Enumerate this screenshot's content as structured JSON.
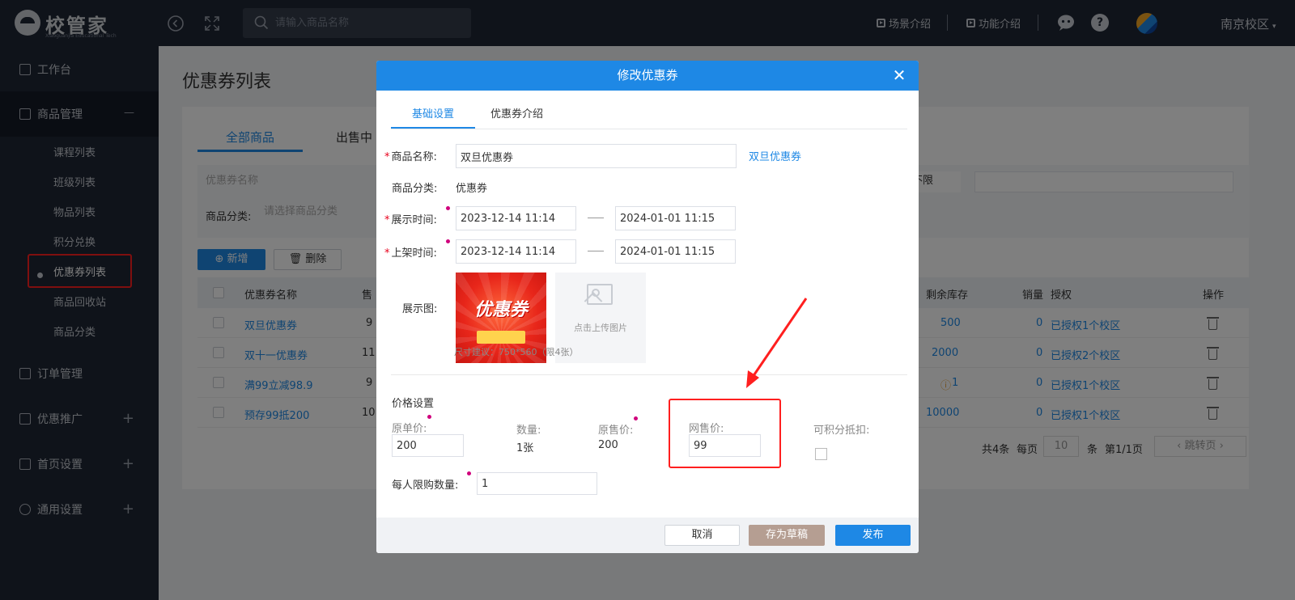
{
  "topbar": {
    "logo_text": "校管家",
    "logo_sub": "Xiaoguanjia Educational Tech",
    "search_placeholder": "请输入商品名称",
    "scene_intro": "场景介绍",
    "feature_intro": "功能介绍",
    "help_glyph": "?",
    "campus": "南京校区",
    "campus_caret": "▾"
  },
  "sidebar": {
    "workbench": "工作台",
    "goods_mgmt": "商品管理",
    "goods_sub": [
      "课程列表",
      "班级列表",
      "物品列表",
      "积分兑换",
      "优惠券列表",
      "商品回收站",
      "商品分类"
    ],
    "order_mgmt": "订单管理",
    "promotion": "优惠推广",
    "home_settings": "首页设置",
    "general_settings": "通用设置",
    "minus": "—",
    "plus": "+"
  },
  "page": {
    "title": "优惠券列表",
    "tabs": [
      "全部商品",
      "出售中"
    ],
    "filter_name_placeholder": "优惠券名称",
    "filter_category_label": "商品分类:",
    "filter_category_placeholder": "请选择商品分类",
    "filter_select_value": "不限",
    "add_button": "新增",
    "delete_button": "删除",
    "columns": {
      "name": "优惠券名称",
      "sold_short": "售",
      "stock": "剩余库存",
      "sales": "销量",
      "auth": "授权",
      "ops": "操作"
    },
    "rows": [
      {
        "name": "双旦优惠券",
        "price": "9",
        "stock": "500",
        "sales": "0",
        "auth": "已授权1个校区"
      },
      {
        "name": "双十一优惠券",
        "price": "11",
        "stock": "2000",
        "sales": "0",
        "auth": "已授权2个校区"
      },
      {
        "name": "满99立减98.9",
        "price": "9",
        "stock": "1",
        "sales": "0",
        "auth": "已授权1个校区"
      },
      {
        "name": "预存99抵200",
        "price": "10",
        "stock": "10000",
        "sales": "0",
        "auth": "已授权1个校区"
      }
    ],
    "pager": {
      "total": "共4条",
      "per_page_label": "每页",
      "per_page_value": "10",
      "unit": "条",
      "page_info": "第1/1页",
      "jump": "跳转页"
    }
  },
  "modal": {
    "title": "修改优惠券",
    "close_glyph": "✕",
    "tabs": [
      "基础设置",
      "优惠券介绍"
    ],
    "name_label": "商品名称:",
    "name_value": "双旦优惠券",
    "name_link": "双旦优惠券",
    "category_label": "商品分类:",
    "category_value": "优惠券",
    "display_time_label": "展示时间:",
    "display_start": "2023-12-14 11:14",
    "display_end": "2024-01-01 11:15",
    "shelf_time_label": "上架时间:",
    "shelf_start": "2023-12-14 11:14",
    "shelf_end": "2024-01-01 11:15",
    "image_label": "展示图:",
    "coupon_image_text": "优惠券",
    "upload_label": "点击上传图片",
    "size_hint": "尺寸建议：750*560（限4张）",
    "price_section": "价格设置",
    "original_price_label": "原单价:",
    "original_price_value": "200",
    "quantity_label": "数量:",
    "quantity_value": "1张",
    "original_sale_label": "原售价:",
    "original_sale_value": "200",
    "online_price_label": "网售价:",
    "online_price_value": "99",
    "points_label": "可积分抵扣:",
    "limit_label": "每人限购数量:",
    "limit_value": "1",
    "cancel": "取消",
    "draft": "存为草稿",
    "publish": "发布"
  },
  "colors": {
    "primary": "#1e88e5",
    "sidebar_bg": "#1f2634",
    "highlight_red": "#ff1f1f",
    "draft_btn": "#b59e92"
  }
}
